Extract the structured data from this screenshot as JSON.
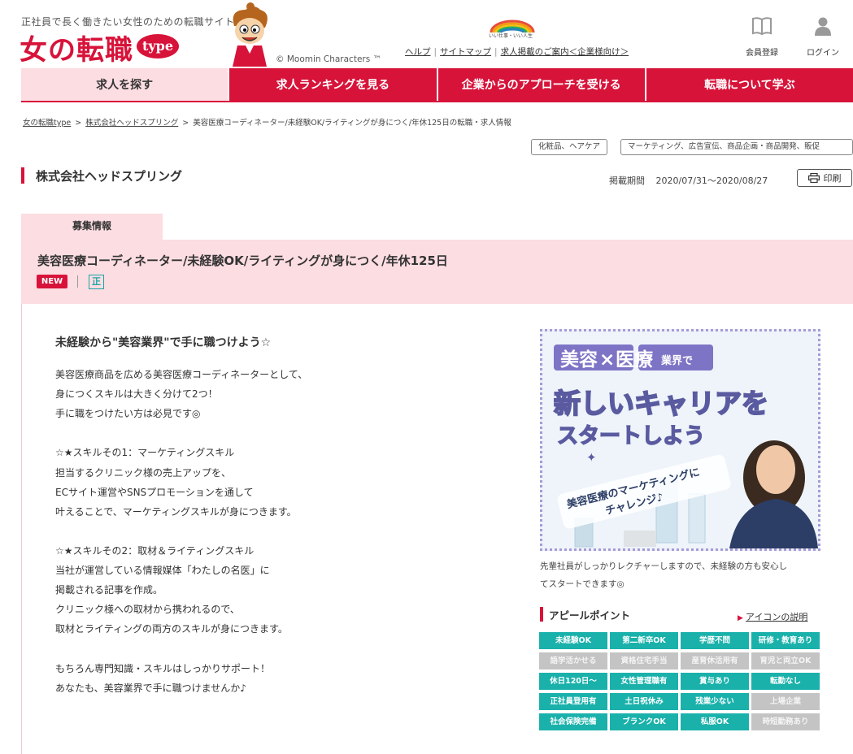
{
  "header": {
    "tagline": "正社員で長く働きたい女性のための転職サイト",
    "logo": "女の転職",
    "logo_badge": "type",
    "copyright": "© Moomin Characters ™",
    "rainbow_text": "いい仕事・いい人生",
    "links": [
      "ヘルプ",
      "サイトマップ",
      "求人掲載のご案内＜企業様向け＞"
    ],
    "register_label": "会員登録",
    "login_label": "ログイン"
  },
  "nav": [
    {
      "label": "求人を探す",
      "active": true
    },
    {
      "label": "求人ランキングを見る",
      "active": false
    },
    {
      "label": "企業からのアプローチを受ける",
      "active": false
    },
    {
      "label": "転職について学ぶ",
      "active": false
    }
  ],
  "breadcrumb": {
    "items": [
      "女の転職type",
      "株式会社ヘッドスプリング"
    ],
    "current": "美容医療コーディネーター/未経験OK/ライティングが身につく/年休125日の転職・求人情報"
  },
  "tags": [
    "化粧品、ヘアケア",
    "マーケティング、広告宣伝、商品企画・商品開発、販促"
  ],
  "company": {
    "name": "株式会社ヘッドスプリング",
    "period_label": "掲載期間",
    "period": "2020/07/31〜2020/08/27",
    "print_label": "印刷"
  },
  "recruit": {
    "tab_label": "募集情報",
    "title": "美容医療コーディネーター/未経験OK/ライティングが身につく/年休125日",
    "new_badge": "NEW",
    "employment_badge": "正"
  },
  "content": {
    "headline": "未経験から\"美容業界\"で手に職つけよう☆",
    "paragraphs": [
      "美容医療商品を広める美容医療コーディネーターとして、",
      "身につくスキルは大きく分けて2つ！",
      "手に職をつけたい方は必見です◎",
      "",
      "☆★スキルその1：マーケティングスキル",
      "担当するクリニック様の売上アップを、",
      "ECサイト運営やSNSプロモーションを通して",
      "叶えることで、マーケティングスキルが身につきます。",
      "",
      "☆★スキルその2：取材＆ライティングスキル",
      "当社が運営している情報媒体「わたしの名医」に",
      "掲載される記事を作成。",
      "クリニック様への取材から携われるので、",
      "取材とライティングの両方のスキルが身につきます。",
      "",
      "もちろん専門知識・スキルはしっかりサポート！",
      "あなたも、美容業界で手に職つけませんか♪"
    ]
  },
  "banner": {
    "line1a": "美容",
    "line1x": "×",
    "line1b": "医療",
    "line1c": "業界で",
    "line2": "新しいキャリアを",
    "line3": "スタートしよう",
    "line4": "美容医療のマーケティングに",
    "line5": "チャレンジ♪"
  },
  "caption": [
    "先輩社員がしっかりレクチャーしますので、未経験の方も安心し",
    "てスタートできます◎"
  ],
  "appeal": {
    "title": "アピールポイント",
    "icon_link": "アイコンの説明",
    "items": [
      {
        "label": "未経験OK",
        "on": true
      },
      {
        "label": "第二新卒OK",
        "on": true
      },
      {
        "label": "学歴不問",
        "on": true
      },
      {
        "label": "研修・教育あり",
        "on": true
      },
      {
        "label": "語学活かせる",
        "on": false
      },
      {
        "label": "資格住宅手当",
        "on": false
      },
      {
        "label": "産育休活用有",
        "on": false
      },
      {
        "label": "育児と両立OK",
        "on": false
      },
      {
        "label": "休日120日〜",
        "on": true
      },
      {
        "label": "女性管理職有",
        "on": true
      },
      {
        "label": "賞与あり",
        "on": true
      },
      {
        "label": "転勤なし",
        "on": true
      },
      {
        "label": "正社員登用有",
        "on": true
      },
      {
        "label": "土日祝休み",
        "on": true
      },
      {
        "label": "残業少ない",
        "on": true
      },
      {
        "label": "上場企業",
        "on": false
      },
      {
        "label": "社会保険完備",
        "on": true
      },
      {
        "label": "ブランクOK",
        "on": true
      },
      {
        "label": "私服OK",
        "on": true
      },
      {
        "label": "時短勤務あり",
        "on": false
      }
    ]
  },
  "colors": {
    "brand": "#d7133a",
    "pink": "#fcdde2",
    "teal": "#1ab1ab",
    "gray": "#c4c4c4"
  }
}
